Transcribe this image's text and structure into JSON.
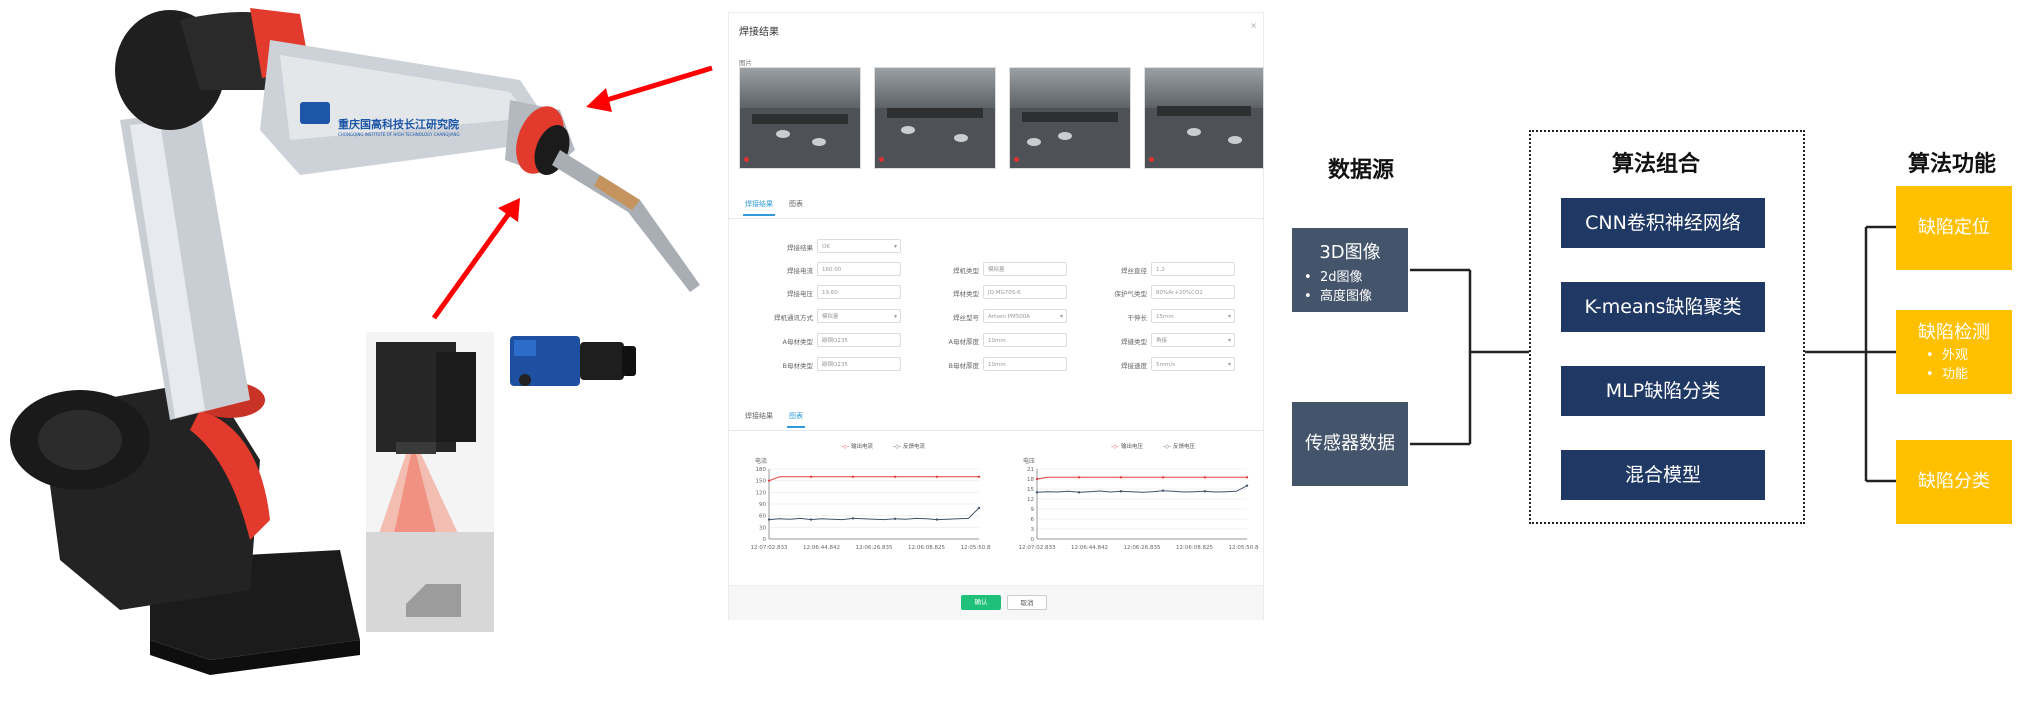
{
  "photo": {
    "logo_name": "重庆国高科技长江研究院",
    "logo_en": "CHONGQING INSTITUTE OF HIGH TECHNOLOGY CHANGJIANG"
  },
  "app": {
    "title": "焊接结果",
    "image_section": "图片",
    "tabs_top": [
      "焊接结果",
      "图表"
    ],
    "form": {
      "col1": [
        {
          "label": "焊接结果",
          "value": "OK",
          "select": true
        },
        {
          "label": "焊接电流",
          "value": "160.00",
          "select": false
        },
        {
          "label": "焊接电压",
          "value": "19.60",
          "select": false
        },
        {
          "label": "焊机通讯方式",
          "value": "模拟量",
          "select": true
        },
        {
          "label": "A母材类型",
          "value": "碳钢Q235",
          "select": false
        },
        {
          "label": "B母材类型",
          "value": "碳钢Q235",
          "select": false
        }
      ],
      "col2": [
        {
          "label": "焊机类型",
          "value": "模拟量",
          "select": false
        },
        {
          "label": "焊材类型",
          "value": "JQ·MG70S-6",
          "select": false
        },
        {
          "label": "焊丝型号",
          "value": "Artsen PM500A",
          "select": true
        },
        {
          "label": "A母材厚度",
          "value": "10mm",
          "select": false
        },
        {
          "label": "B母材厚度",
          "value": "10mm",
          "select": false
        }
      ],
      "col3": [
        {
          "label": "焊丝直径",
          "value": "1.2",
          "select": false
        },
        {
          "label": "保护气类型",
          "value": "80%Ar+20%CO2",
          "select": false
        },
        {
          "label": "干伸长",
          "value": "15mm",
          "select": true
        },
        {
          "label": "焊缝类型",
          "value": "角接",
          "select": true
        },
        {
          "label": "焊接速度",
          "value": "5mm/s",
          "select": true
        }
      ]
    },
    "tabs_bottom": [
      "焊接结果",
      "图表"
    ],
    "legend": [
      "输出电流",
      "反馈电流",
      "输出电压",
      "反馈电压"
    ],
    "buttons": {
      "ok": "确认",
      "cancel": "取消"
    }
  },
  "chart_data": [
    {
      "type": "line",
      "ylabel": "电流",
      "ylim": [
        0,
        180
      ],
      "yticks": [
        0,
        30,
        60,
        90,
        120,
        150,
        180
      ],
      "xticks": [
        "12:07:02.833",
        "12:06:44.842",
        "12:06:26.835",
        "12:06:08.825",
        "12:05:50.847"
      ],
      "series": [
        {
          "name": "输出电流",
          "color": "#e0403f",
          "values": [
            150,
            160,
            160,
            160,
            160,
            160,
            160,
            160,
            160,
            160,
            160,
            160,
            160,
            160,
            160,
            160,
            160,
            160,
            160,
            160,
            160
          ]
        },
        {
          "name": "反馈电流",
          "color": "#43536a",
          "values": [
            50,
            52,
            51,
            53,
            50,
            52,
            51,
            50,
            53,
            52,
            51,
            50,
            52,
            51,
            53,
            52,
            50,
            51,
            52,
            53,
            80
          ]
        }
      ]
    },
    {
      "type": "line",
      "ylabel": "电压",
      "ylim": [
        0,
        21
      ],
      "yticks": [
        0,
        3,
        6,
        9,
        12,
        15,
        18,
        21
      ],
      "xticks": [
        "12:07:02.833",
        "12:06:44.842",
        "12:06:26.835",
        "12:06:08.825",
        "12:05:50.847"
      ],
      "series": [
        {
          "name": "输出电压",
          "color": "#e0403f",
          "values": [
            18,
            18.5,
            18.5,
            18.5,
            18.5,
            18.5,
            18.5,
            18.5,
            18.5,
            18.5,
            18.5,
            18.5,
            18.5,
            18.5,
            18.5,
            18.5,
            18.5,
            18.5,
            18.5,
            18.5,
            18.5
          ]
        },
        {
          "name": "反馈电压",
          "color": "#43536a",
          "values": [
            14,
            14.2,
            14.1,
            14.3,
            14.0,
            14.2,
            14.4,
            14.1,
            14.3,
            14.2,
            14.0,
            14.2,
            14.5,
            14.3,
            14.1,
            14.2,
            14.3,
            14.1,
            14.2,
            14.3,
            16
          ]
        }
      ]
    }
  ],
  "diagram": {
    "heading_source": "数据源",
    "heading_algo": "算法组合",
    "heading_func": "算法功能",
    "source_3d": {
      "title": "3D图像",
      "items": [
        "2d图像",
        "高度图像"
      ]
    },
    "source_sensor": "传感器数据",
    "algorithms": [
      "CNN卷积神经网络",
      "K-means缺陷聚类",
      "MLP缺陷分类",
      "混合模型"
    ],
    "func_locate": "缺陷定位",
    "func_detect": {
      "title": "缺陷检测",
      "items": [
        "外观",
        "功能"
      ]
    },
    "func_classify": "缺陷分类",
    "colors": {
      "source": "#44546a",
      "algorithm": "#1f3864",
      "function": "#ffc000",
      "arrow": "#ff0000"
    }
  }
}
